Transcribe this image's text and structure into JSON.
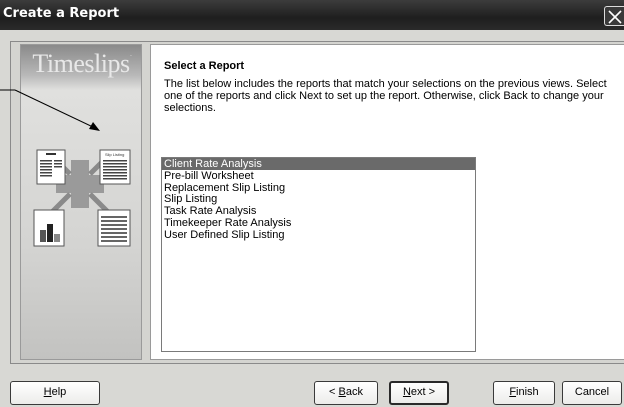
{
  "window": {
    "title": "Create a Report"
  },
  "sidebar": {
    "brand": "Timeslips",
    "brand_mark": ".",
    "illustration_label": "Slip Listing"
  },
  "main": {
    "heading": "Select a Report",
    "description": "The list below includes the reports that match your selections on the previous views. Select one of the reports and click Next to set up the report. Otherwise, click Back to change your selections.",
    "reports": [
      {
        "label": "Client Rate Analysis",
        "selected": true
      },
      {
        "label": "Pre-bill Worksheet",
        "selected": false
      },
      {
        "label": "Replacement Slip Listing",
        "selected": false
      },
      {
        "label": "Slip Listing",
        "selected": false
      },
      {
        "label": "Task Rate Analysis",
        "selected": false
      },
      {
        "label": "Timekeeper Rate Analysis",
        "selected": false
      },
      {
        "label": "User Defined Slip Listing",
        "selected": false
      }
    ]
  },
  "buttons": {
    "help": {
      "prefix": "",
      "accel": "H",
      "rest": "elp"
    },
    "back": {
      "prefix": "< ",
      "accel": "B",
      "rest": "ack"
    },
    "next": {
      "prefix": "",
      "accel": "N",
      "rest": "ext >"
    },
    "finish": {
      "prefix": "",
      "accel": "F",
      "rest": "inish"
    },
    "cancel": {
      "label": "Cancel"
    }
  },
  "colors": {
    "selection": "#6a6a6a",
    "titlebar": "#2a2a2a"
  }
}
